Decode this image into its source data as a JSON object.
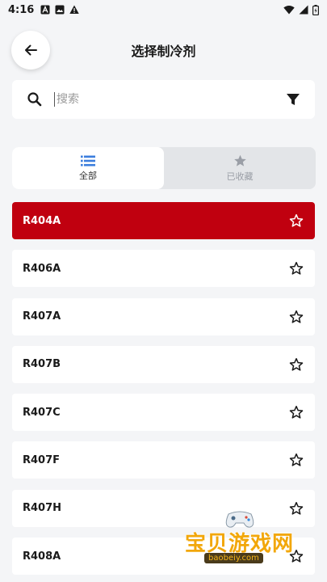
{
  "status_bar": {
    "time": "4:16"
  },
  "header": {
    "title": "选择制冷剂"
  },
  "search": {
    "placeholder": "搜索",
    "value": ""
  },
  "tabs": [
    {
      "label": "全部",
      "icon": "list-icon",
      "active": true
    },
    {
      "label": "已收藏",
      "icon": "star-filled-icon",
      "active": false
    }
  ],
  "refrigerants": [
    {
      "name": "R404A",
      "selected": true
    },
    {
      "name": "R406A",
      "selected": false
    },
    {
      "name": "R407A",
      "selected": false
    },
    {
      "name": "R407B",
      "selected": false
    },
    {
      "name": "R407C",
      "selected": false
    },
    {
      "name": "R407F",
      "selected": false
    },
    {
      "name": "R407H",
      "selected": false
    },
    {
      "name": "R408A",
      "selected": false
    }
  ],
  "watermark": {
    "cn": "宝贝游戏网",
    "en": "baobeiy.com"
  },
  "colors": {
    "accent": "#c0000f",
    "tab_active_icon": "#3b7ddd",
    "background": "#f4f5f7"
  }
}
